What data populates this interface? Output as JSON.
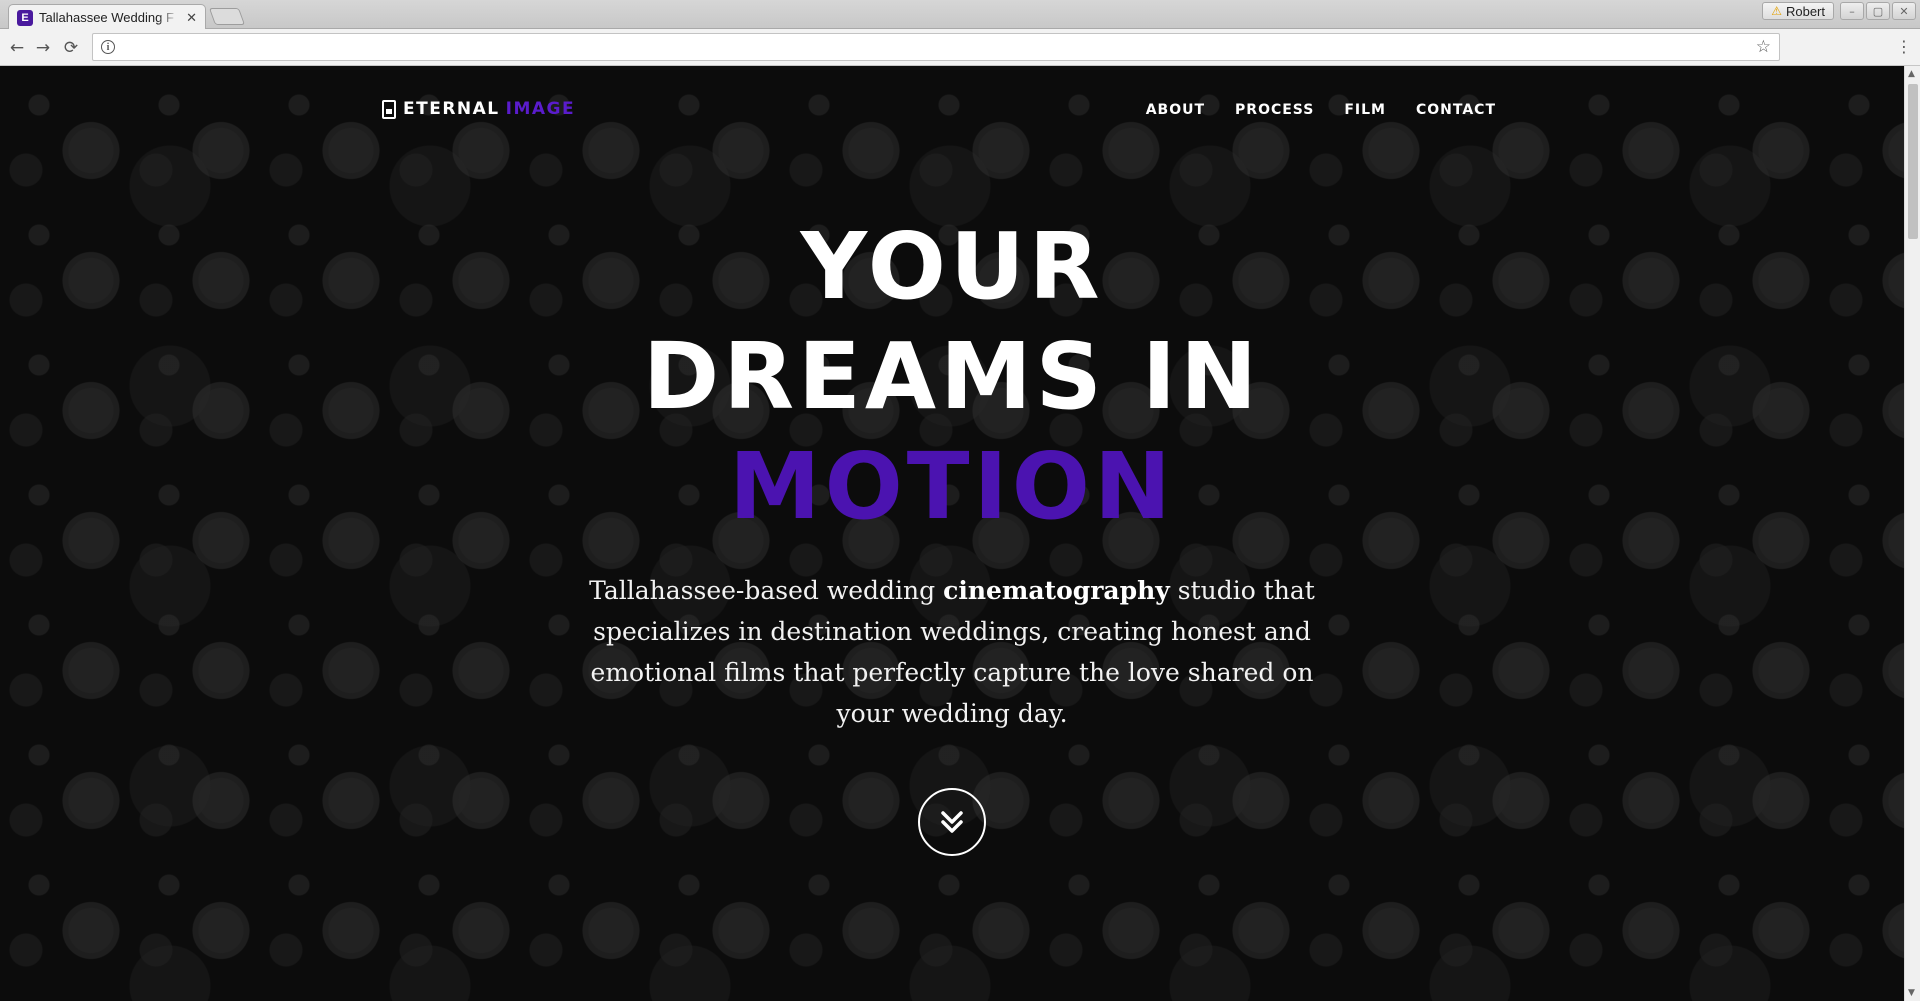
{
  "browser": {
    "tab_title": "Tallahassee Wedding F",
    "tab_close": "✕",
    "profile_name": "Robert",
    "url": "",
    "win_min": "–",
    "win_max": "▢",
    "win_close": "✕"
  },
  "icons": {
    "back": "←",
    "forward": "→",
    "reload": "⟳",
    "info": "i",
    "star": "☆",
    "menu": "⋮",
    "warning": "⚠",
    "favicon": "E"
  },
  "site": {
    "logo_part1": "ETERNAL",
    "logo_part2": "IMAGE",
    "nav": [
      "ABOUT",
      "PROCESS",
      "FILM",
      "CONTACT"
    ],
    "hero_line1": "YOUR",
    "hero_line2": "DREAMS IN",
    "hero_line3": "MOTION",
    "desc_before": "Tallahassee-based wedding ",
    "desc_bold": "cinematography",
    "desc_after": " studio that specializes in destination weddings, creating honest and emotional films that perfectly capture the love shared on your wedding day."
  },
  "colors": {
    "accent": "#4b13b0",
    "logo_accent": "#5a1ccc",
    "background": "#0e0e0e",
    "text": "#ffffff"
  }
}
